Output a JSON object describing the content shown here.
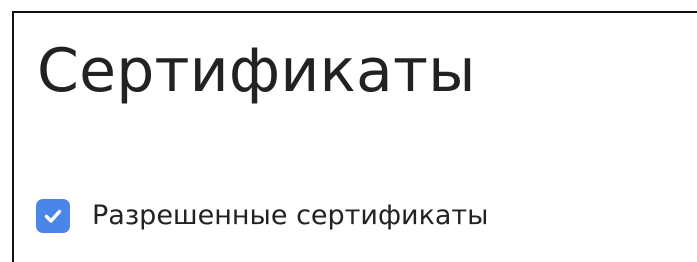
{
  "page": {
    "title": "Сертификаты"
  },
  "settings": {
    "allowed_certificates": {
      "label": "Разрешенные сертификаты",
      "checked": true,
      "accent_color": "#4a86e8",
      "icon": "checkmark-icon"
    }
  }
}
